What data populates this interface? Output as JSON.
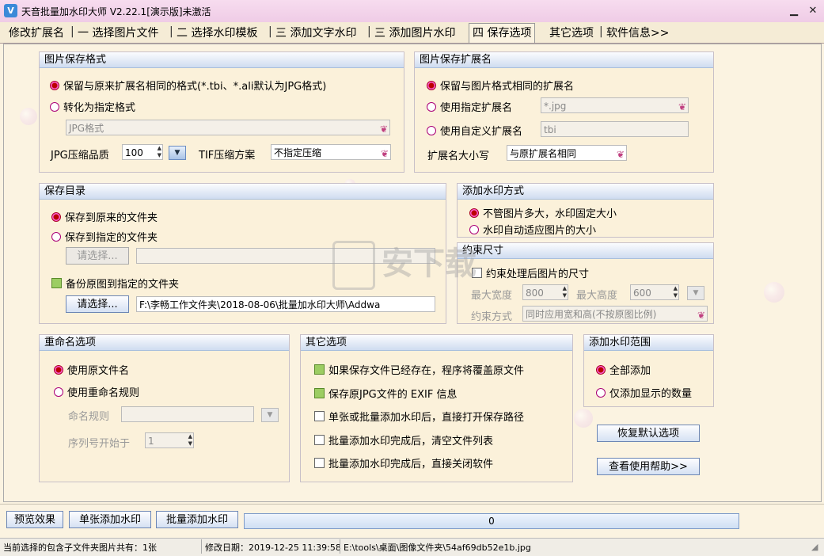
{
  "window": {
    "title": "天音批量加水印大师 V2.22.1[演示版]未激活",
    "app_icon_label": "V"
  },
  "tabs": [
    {
      "label": "修改扩展名"
    },
    {
      "label": "一  选择图片文件"
    },
    {
      "label": "二  选择水印模板"
    },
    {
      "label": "三  添加文字水印"
    },
    {
      "label": "三  添加图片水印"
    },
    {
      "label": "四  保存选项"
    },
    {
      "label": "其它选项"
    },
    {
      "label": "软件信息>>"
    }
  ],
  "tab_separator": "|",
  "save_format": {
    "title": "图片保存格式",
    "keep_label": "保留与原来扩展名相同的格式(*.tbi、*.ali默认为JPG格式)",
    "convert_label": "转化为指定格式",
    "format_value": "JPG格式",
    "jpg_quality_label": "JPG压缩品质",
    "jpg_quality_value": "100",
    "tif_label": "TIF压缩方案",
    "tif_value": "不指定压缩"
  },
  "save_ext": {
    "title": "图片保存扩展名",
    "keep_label": "保留与图片格式相同的扩展名",
    "specified_label": "使用指定扩展名",
    "specified_value": "*.jpg",
    "custom_label": "使用自定义扩展名",
    "custom_value": "tbi",
    "case_label": "扩展名大小写",
    "case_value": "与原扩展名相同"
  },
  "save_dir": {
    "title": "保存目录",
    "original_label": "保存到原来的文件夹",
    "specified_label": "保存到指定的文件夹",
    "choose_label": "请选择...",
    "specified_path": "",
    "backup_label": "备份原图到指定的文件夹",
    "choose2_label": "请选择...",
    "backup_path": "F:\\李畅工作文件夹\\2018-08-06\\批量加水印大师\\Addwa"
  },
  "watermark_mode": {
    "title": "添加水印方式",
    "fixed_label": "不管图片多大，水印固定大小",
    "auto_label": "水印自动适应图片的大小"
  },
  "constraint": {
    "title": "约束尺寸",
    "enable_label": "约束处理后图片的尺寸",
    "max_width_label": "最大宽度",
    "max_width_value": "800",
    "max_height_label": "最大高度",
    "max_height_value": "600",
    "mode_label": "约束方式",
    "mode_value": "同时应用宽和高(不按原图比例)"
  },
  "rename": {
    "title": "重命名选项",
    "original_label": "使用原文件名",
    "rule_label": "使用重命名规则",
    "naming_rule_label": "命名规则",
    "naming_rule_value": "",
    "seq_label": "序列号开始于",
    "seq_value": "1"
  },
  "other": {
    "title": "其它选项",
    "items": [
      {
        "label": "如果保存文件已经存在，程序将覆盖原文件",
        "checked": true
      },
      {
        "label": "保存原JPG文件的 EXIF 信息",
        "checked": true
      },
      {
        "label": "单张或批量添加水印后，直接打开保存路径",
        "checked": false
      },
      {
        "label": "批量添加水印完成后，清空文件列表",
        "checked": false
      },
      {
        "label": "批量添加水印完成后，直接关闭软件",
        "checked": false
      }
    ]
  },
  "range": {
    "title": "添加水印范围",
    "all_label": "全部添加",
    "visible_label": "仅添加显示的数量"
  },
  "side_buttons": {
    "restore_label": "恢复默认选项",
    "help_label": "查看使用帮助>>"
  },
  "bottom": {
    "preview_label": "预览效果",
    "single_label": "单张添加水印",
    "batch_label": "批量添加水印",
    "progress_text": "0",
    "progress_value": 0
  },
  "status": {
    "count_text": "当前选择的包含子文件夹图片共有：1张",
    "modified_text": "修改日期：2019-12-25 11:39:58",
    "path_text": "E:\\tools\\桌面\\图像文件夹\\54af69db52e1b.jpg"
  },
  "watermark_overlay": {
    "text": "安下载"
  },
  "colors": {
    "title_bg": "#f7dcef",
    "panel_bg": "#fbf1da",
    "group_header": "#cfdcf0"
  }
}
